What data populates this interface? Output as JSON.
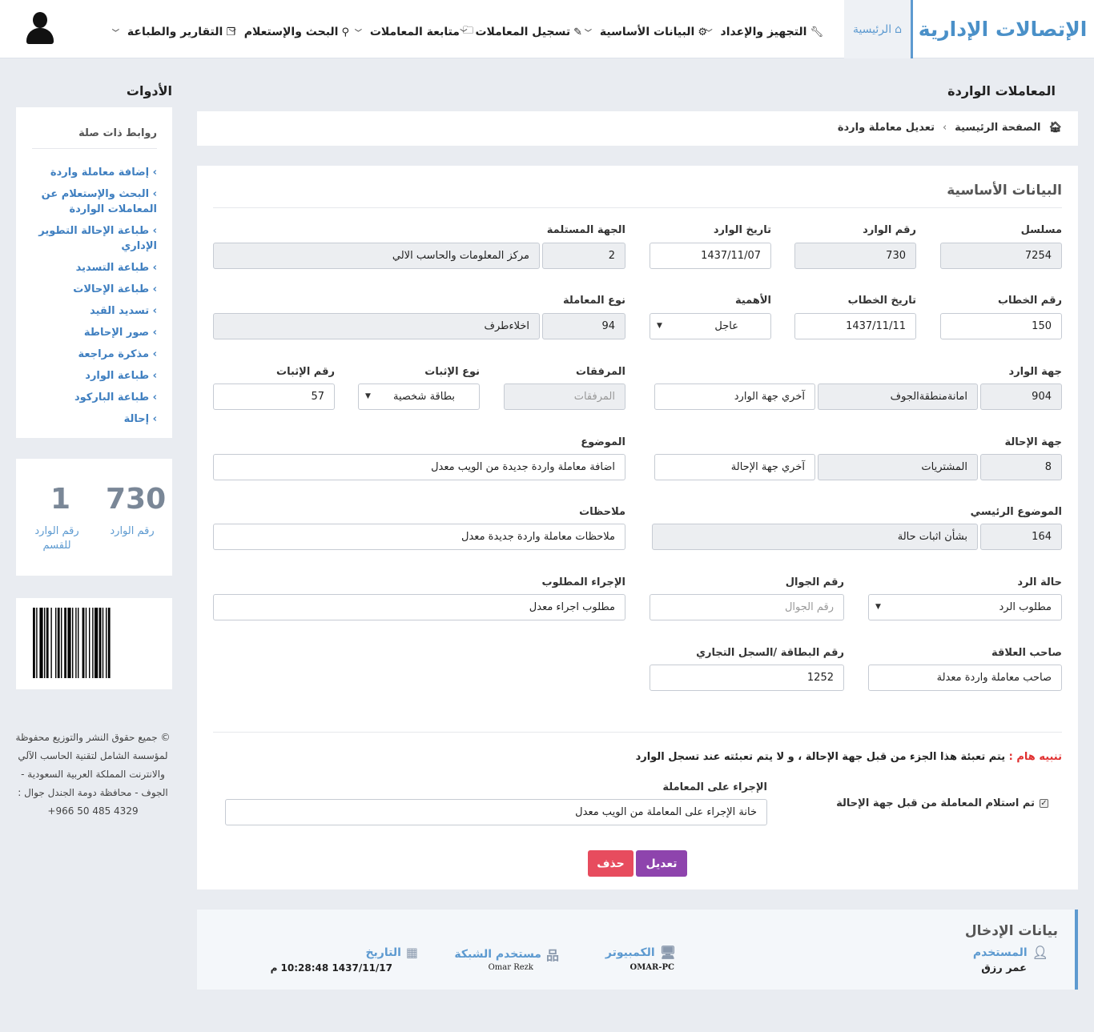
{
  "app": {
    "logo": "الإتصالات الإدارية"
  },
  "nav": {
    "home": "الرئيسية",
    "items": [
      {
        "label": "التجهيز والإعداد",
        "icon": "wrench-icon"
      },
      {
        "label": "البيانات الأساسية",
        "icon": "gear-icon"
      },
      {
        "label": "تسجيل المعاملات",
        "icon": "pencil-icon"
      },
      {
        "label": "متابعة المعاملات",
        "icon": "folder-icon"
      },
      {
        "label": "البحث والإستعلام",
        "icon": "search-icon"
      },
      {
        "label": "التقارير والطباعة",
        "icon": "copy-icon"
      }
    ]
  },
  "page": {
    "title": "المعاملات الواردة",
    "tools_title": "الأدوات"
  },
  "breadcrumb": {
    "home": "الصفحة الرئيسية",
    "current": "تعديل معاملة واردة"
  },
  "form": {
    "section_title": "البيانات الأساسية",
    "serial": {
      "label": "مسلسل",
      "value": "7254"
    },
    "incoming_no": {
      "label": "رقم الوارد",
      "value": "730"
    },
    "incoming_date": {
      "label": "تاريخ الوارد",
      "value": "1437/11/07"
    },
    "receiving_party": {
      "label": "الجهة المستلمة",
      "code": "2",
      "name": "مركز المعلومات والحاسب الالي"
    },
    "letter_no": {
      "label": "رقم الخطاب",
      "value": "150"
    },
    "letter_date": {
      "label": "تاريخ الخطاب",
      "value": "1437/11/11"
    },
    "importance": {
      "label": "الأهمية",
      "value": "عاجل"
    },
    "transaction_type": {
      "label": "نوع المعاملة",
      "code": "94",
      "name": "اخلاءطرف"
    },
    "incoming_party": {
      "label": "جهة الوارد",
      "code": "904",
      "name": "امانةمنطقةالجوف",
      "last": "آخري جهة الوارد"
    },
    "attachments": {
      "label": "المرفقات",
      "placeholder": "المرفقات"
    },
    "proof_type": {
      "label": "نوع الإثبات",
      "value": "بطاقة شخصية"
    },
    "proof_no": {
      "label": "رقم الإثبات",
      "value": "57"
    },
    "referral_party": {
      "label": "جهة الإحالة",
      "code": "8",
      "name": "المشتريات",
      "last": "آخري جهة الإحالة"
    },
    "subject": {
      "label": "الموضوع",
      "value": "اضافة معاملة واردة جديدة من الويب معدل"
    },
    "main_subject": {
      "label": "الموضوع الرئيسي",
      "code": "164",
      "name": "بشأن اثبات حالة"
    },
    "notes": {
      "label": "ملاحظات",
      "value": "ملاحظات معاملة واردة جديدة معدل"
    },
    "reply_status": {
      "label": "حالة الرد",
      "value": "مطلوب الرد"
    },
    "mobile": {
      "label": "رقم الجوال",
      "placeholder": "رقم الجوال"
    },
    "required_action": {
      "label": "الإجراء المطلوب",
      "value": "مطلوب اجراء معدل"
    },
    "owner": {
      "label": "صاحب العلاقة",
      "value": "صاحب معاملة واردة معدلة"
    },
    "id_no": {
      "label": "رقم البطاقة /السجل التجاري",
      "value": "1252"
    },
    "notice_prefix": "تنبيه هام :",
    "notice_text": "يتم تعبئة هذا الجزء من قبل جهة الإحالة ، و لا يتم تعبئته عند تسجل الوارد",
    "received_check": {
      "label": "تم استلام المعاملة من قبل جهة الإحالة",
      "checked": true
    },
    "action_taken": {
      "label": "الإجراء على المعاملة",
      "value": "خانة الإجراء على المعاملة من الويب معدل"
    },
    "edit_button": "تعديل",
    "delete_button": "حذف"
  },
  "entry": {
    "title": "بيانات الإدخال",
    "user_label": "المستخدم",
    "user_value": "عمر رزق",
    "computer_label": "الكمبيوتر",
    "computer_value": "OMAR-PC",
    "network_label": "مستخدم الشبكة",
    "network_value": "Omar Rezk",
    "date_label": "التاريخ",
    "date_value": "1437/11/17 10:28:48 م"
  },
  "sidebar": {
    "related_title": "روابط ذات صلة",
    "links": [
      "إضافة معاملة واردة",
      "البحث والإستعلام عن المعاملات الواردة",
      "طباعة الإحالة التطوير الإداري",
      "طباعة التسديد",
      "طباعة الإحالات",
      "تسديد القيد",
      "صور الإحاطة",
      "مذكرة مراجعة",
      "طباعة الوارد",
      "طباعة الباركود",
      "إحالة"
    ],
    "stat_incoming_no": "730",
    "stat_incoming_label": "رقم الوارد",
    "stat_dept_no": "1",
    "stat_dept_label": "رقم الوارد للقسم",
    "footer": "© جميع حقوق النشر والتوزيع محفوظة لمؤسسة الشامل لتقنية الحاسب الآلي والانترنت المملكة العربية السعودية - الجوف - محافظة دومة الجندل جوال : 4329 485 50 966+"
  }
}
